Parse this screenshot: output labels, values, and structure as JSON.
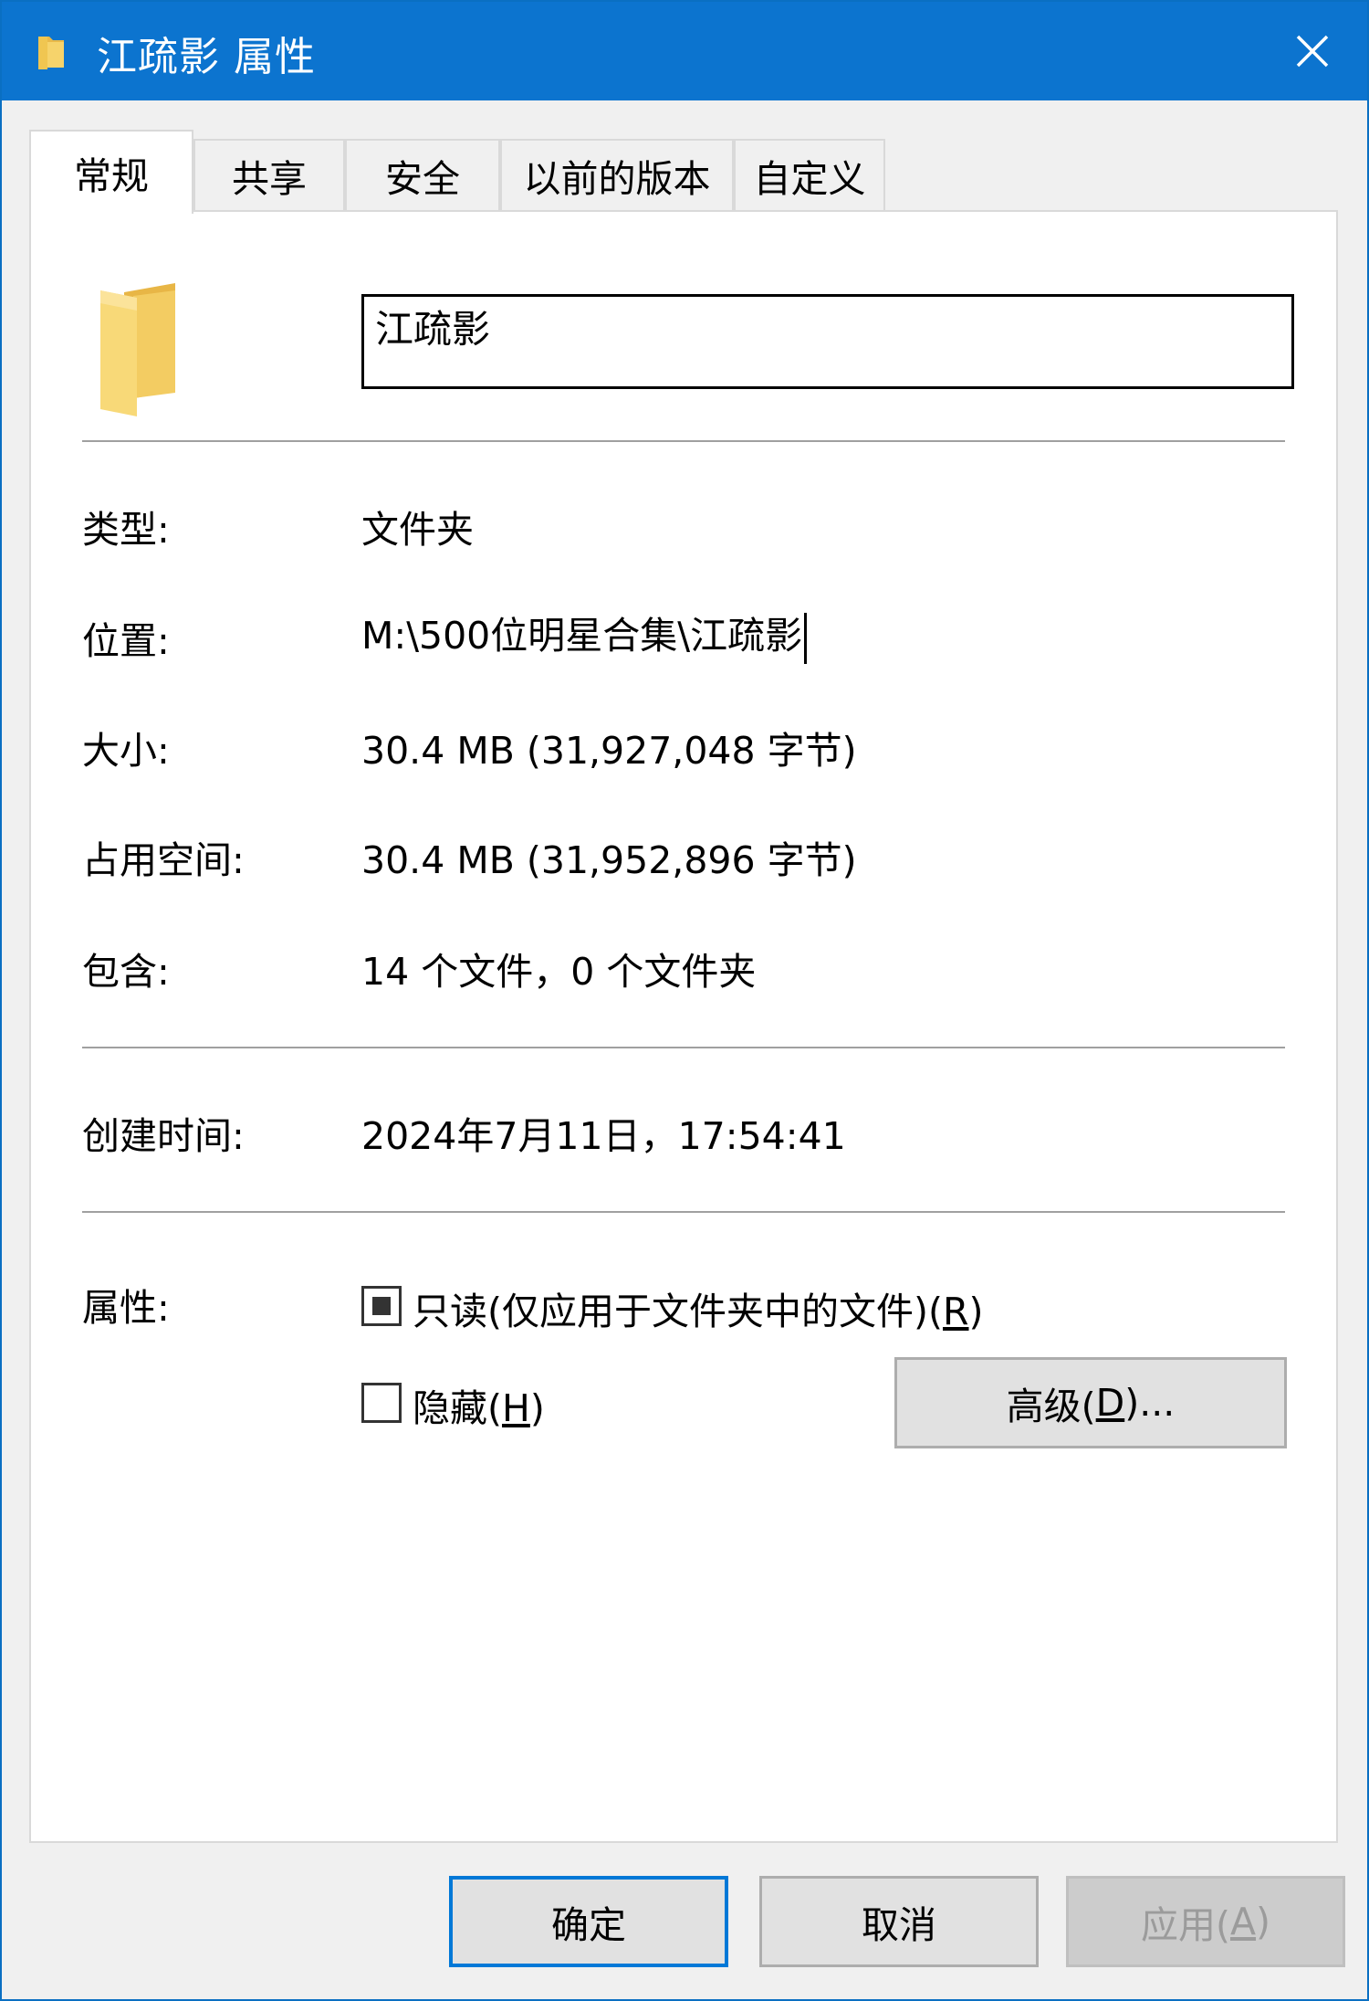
{
  "window": {
    "title": "江疏影 属性",
    "accent_color": "#0c74cf",
    "title_icon": "folder-icon",
    "close_icon": "close-icon"
  },
  "tabs": [
    {
      "label": "常规",
      "active": true
    },
    {
      "label": "共享",
      "active": false
    },
    {
      "label": "安全",
      "active": false
    },
    {
      "label": "以前的版本",
      "active": false
    },
    {
      "label": "自定义",
      "active": false
    }
  ],
  "general": {
    "folder_name": "江疏影",
    "type_label": "类型:",
    "type_value": "文件夹",
    "location_label": "位置:",
    "location_value": "M:\\500位明星合集\\江疏影",
    "size_label": "大小:",
    "size_value": "30.4 MB (31,927,048 字节)",
    "disk_label": "占用空间:",
    "disk_value": "30.4 MB (31,952,896 字节)",
    "contains_label": "包含:",
    "contains_value": "14 个文件，0 个文件夹",
    "created_label": "创建时间:",
    "created_value": "2024年7月11日，17:54:41",
    "attributes_label": "属性:",
    "readonly_label": "只读(仅应用于文件夹中的文件)(",
    "readonly_key": "R",
    "readonly_end": ")",
    "readonly_state": "indeterminate",
    "hidden_label": "隐藏(",
    "hidden_key": "H",
    "hidden_end": ")",
    "hidden_checked": false,
    "advanced_label": "高级(",
    "advanced_key": "D",
    "advanced_end": ")..."
  },
  "footer": {
    "ok_label": "确定",
    "cancel_label": "取消",
    "apply_label": "应用(",
    "apply_key": "A",
    "apply_end": ")"
  }
}
